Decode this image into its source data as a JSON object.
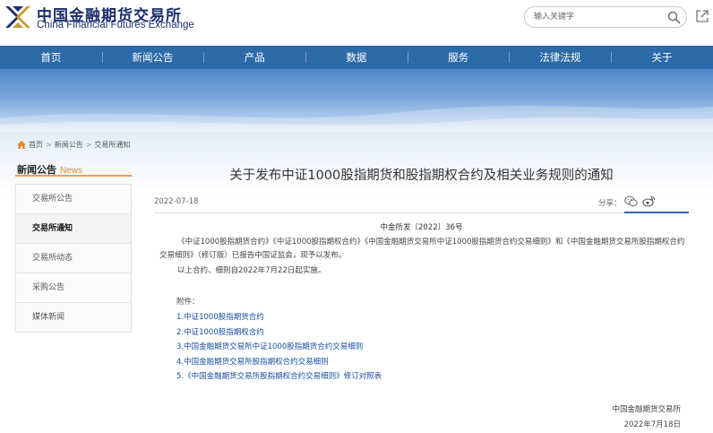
{
  "header": {
    "logo_cn": "中国金融期货交易所",
    "logo_en": "China Financial Futures Exchange",
    "search_placeholder": "输入关键字"
  },
  "nav": {
    "items": [
      {
        "label": "首页"
      },
      {
        "label": "新闻公告"
      },
      {
        "label": "产品"
      },
      {
        "label": "数据"
      },
      {
        "label": "服务"
      },
      {
        "label": "法律法规"
      },
      {
        "label": "关于"
      }
    ]
  },
  "breadcrumb": {
    "items": [
      "首页",
      "新闻公告",
      "交易所通知"
    ],
    "separator": ">"
  },
  "sidebar": {
    "title_cn": "新闻公告",
    "title_en": "News",
    "items": [
      {
        "label": "交易所公告"
      },
      {
        "label": "交易所通知"
      },
      {
        "label": "交易所动态"
      },
      {
        "label": "采购公告"
      },
      {
        "label": "媒体新闻"
      }
    ],
    "active_index": 1
  },
  "article": {
    "title": "关于发布中证1000股指期货和股指期权合约及相关业务规则的通知",
    "date": "2022-07-18",
    "share_label": "分享：",
    "doc_no": "中金所发〔2022〕36号",
    "para1": "《中证1000股指期货合约》《中证1000股指期权合约》《中国金融期货交易所中证1000股指期货合约交易细则》和《中国金融期货交易所股指期权合约交易细则》（修订版）已报告中国证监会，现予以发布。",
    "para2": "以上合约、细则自2022年7月22日起实施。",
    "attachments_label": "附件：",
    "attachments": [
      "1.中证1000股指期货合约",
      "2.中证1000股指期权合约",
      "3.中国金融期货交易所中证1000股指期货合约交易细则",
      "4.中国金融期货交易所股指期权合约交易细则",
      "5.《中国金融期货交易所股指期权合约交易细则》修订对照表"
    ],
    "signature_org": "中国金融期货交易所",
    "signature_date": "2022年7月18日"
  },
  "colors": {
    "nav_bg": "#2c6aa8",
    "accent": "#f0a040",
    "link": "#1a4fa0",
    "logo": "#1b2f6b"
  }
}
